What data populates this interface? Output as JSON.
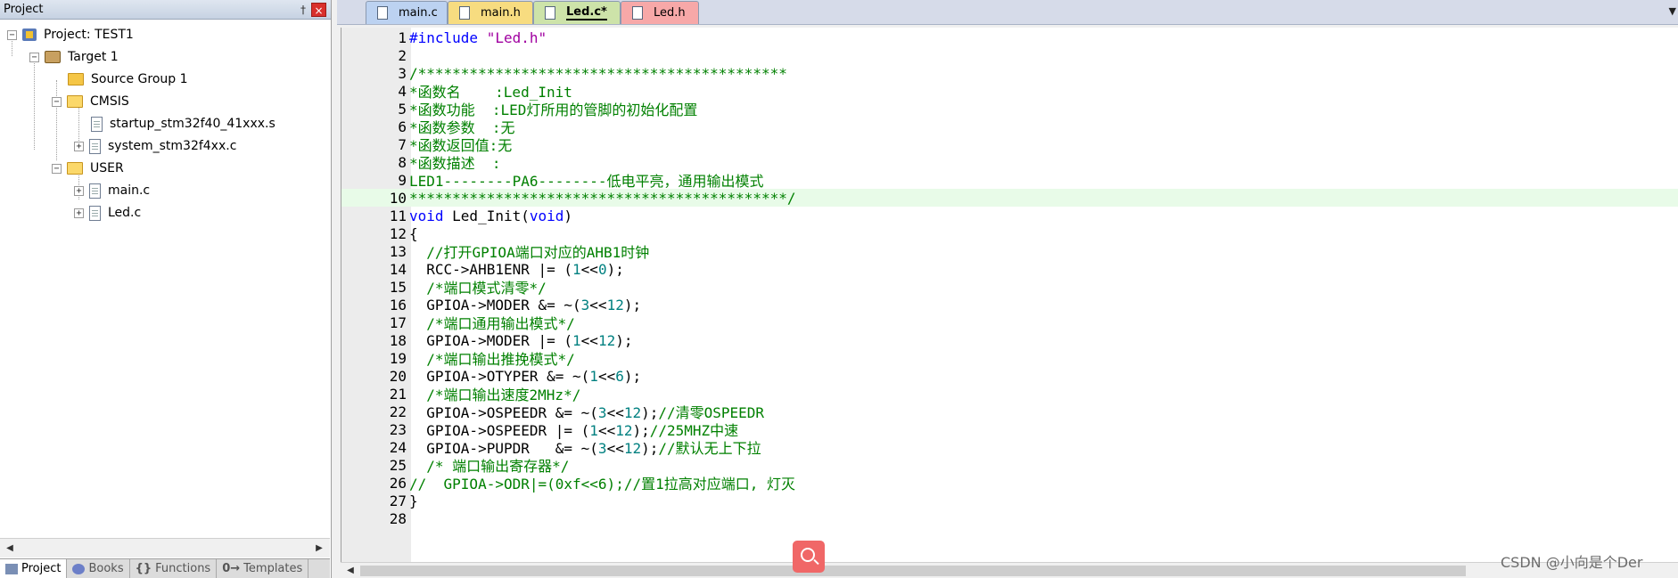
{
  "project_panel": {
    "title": "Project",
    "pin_glyph": "†",
    "close_glyph": "×",
    "tree": [
      {
        "label": "Project: TEST1",
        "icon": "project-icon",
        "expander": "−"
      },
      {
        "label": "Target 1",
        "icon": "target-icon",
        "expander": "−"
      },
      {
        "label": "Source Group 1",
        "icon": "folder-closed-icon",
        "expander": ""
      },
      {
        "label": "CMSIS",
        "icon": "folder-open-icon",
        "expander": "−"
      },
      {
        "label": "startup_stm32f40_41xxx.s",
        "icon": "file-icon",
        "expander": ""
      },
      {
        "label": "system_stm32f4xx.c",
        "icon": "file-icon",
        "expander": "+"
      },
      {
        "label": "USER",
        "icon": "folder-open-icon",
        "expander": "−"
      },
      {
        "label": "main.c",
        "icon": "file-icon",
        "expander": "+"
      },
      {
        "label": "Led.c",
        "icon": "file-icon",
        "expander": "+"
      }
    ],
    "bottom_tabs": [
      {
        "label": "Project",
        "active": true
      },
      {
        "label": "Books",
        "active": false
      },
      {
        "label": "Functions",
        "active": false
      },
      {
        "label": "Templates",
        "active": false
      }
    ],
    "bottom_tab_glyphs": [
      "",
      "",
      "{}",
      "0→"
    ]
  },
  "editor_tabs": [
    {
      "label": "main.c",
      "color": "#bcd2f1"
    },
    {
      "label": "main.h",
      "color": "#f7dc80"
    },
    {
      "label": "Led.c*",
      "color": "#cde3a9",
      "active": true
    },
    {
      "label": "Led.h",
      "color": "#f7a8a8"
    }
  ],
  "editor": {
    "current_line": 10,
    "lines": [
      {
        "n": "1",
        "tokens": [
          [
            "c-keyword",
            "#include "
          ],
          [
            "c-string",
            "\"Led.h\""
          ]
        ]
      },
      {
        "n": "2",
        "tokens": []
      },
      {
        "n": "3",
        "tokens": [
          [
            "c-comment",
            "/*******************************************"
          ]
        ]
      },
      {
        "n": "4",
        "tokens": [
          [
            "c-comment",
            "*函数名    :Led_Init"
          ]
        ]
      },
      {
        "n": "5",
        "tokens": [
          [
            "c-comment",
            "*函数功能  :LED灯所用的管脚的初始化配置"
          ]
        ]
      },
      {
        "n": "6",
        "tokens": [
          [
            "c-comment",
            "*函数参数  :无"
          ]
        ]
      },
      {
        "n": "7",
        "tokens": [
          [
            "c-comment",
            "*函数返回值:无"
          ]
        ]
      },
      {
        "n": "8",
        "tokens": [
          [
            "c-comment",
            "*函数描述  :"
          ]
        ]
      },
      {
        "n": "9",
        "tokens": [
          [
            "c-comment",
            "LED1--------PA6--------低电平亮，通用输出模式"
          ]
        ]
      },
      {
        "n": "10",
        "tokens": [
          [
            "c-comment",
            "********************************************/"
          ]
        ]
      },
      {
        "n": "11",
        "tokens": [
          [
            "c-keyword",
            "void"
          ],
          [
            "c-text",
            " Led_Init("
          ],
          [
            "c-keyword",
            "void"
          ],
          [
            "c-text",
            ")"
          ]
        ]
      },
      {
        "n": "12",
        "tokens": [
          [
            "c-text",
            "{"
          ]
        ]
      },
      {
        "n": "13",
        "tokens": [
          [
            "c-text",
            "  "
          ],
          [
            "c-comment",
            "//打开GPIOA端口对应的AHB1时钟"
          ]
        ]
      },
      {
        "n": "14",
        "tokens": [
          [
            "c-text",
            "  RCC->AHB1ENR |= ("
          ],
          [
            "c-num",
            "1"
          ],
          [
            "c-text",
            "<<"
          ],
          [
            "c-num",
            "0"
          ],
          [
            "c-text",
            ");"
          ]
        ]
      },
      {
        "n": "15",
        "tokens": [
          [
            "c-text",
            "  "
          ],
          [
            "c-comment",
            "/*端口模式清零*/"
          ]
        ]
      },
      {
        "n": "16",
        "tokens": [
          [
            "c-text",
            "  GPIOA->MODER &= ~("
          ],
          [
            "c-num",
            "3"
          ],
          [
            "c-text",
            "<<"
          ],
          [
            "c-num",
            "12"
          ],
          [
            "c-text",
            ");"
          ]
        ]
      },
      {
        "n": "17",
        "tokens": [
          [
            "c-text",
            "  "
          ],
          [
            "c-comment",
            "/*端口通用输出模式*/"
          ]
        ]
      },
      {
        "n": "18",
        "tokens": [
          [
            "c-text",
            "  GPIOA->MODER |= ("
          ],
          [
            "c-num",
            "1"
          ],
          [
            "c-text",
            "<<"
          ],
          [
            "c-num",
            "12"
          ],
          [
            "c-text",
            ");"
          ]
        ]
      },
      {
        "n": "19",
        "tokens": [
          [
            "c-text",
            "  "
          ],
          [
            "c-comment",
            "/*端口输出推挽模式*/"
          ]
        ]
      },
      {
        "n": "20",
        "tokens": [
          [
            "c-text",
            "  GPIOA->OTYPER &= ~("
          ],
          [
            "c-num",
            "1"
          ],
          [
            "c-text",
            "<<"
          ],
          [
            "c-num",
            "6"
          ],
          [
            "c-text",
            ");"
          ]
        ]
      },
      {
        "n": "21",
        "tokens": [
          [
            "c-text",
            "  "
          ],
          [
            "c-comment",
            "/*端口输出速度2MHz*/"
          ]
        ]
      },
      {
        "n": "22",
        "tokens": [
          [
            "c-text",
            "  GPIOA->OSPEEDR &= ~("
          ],
          [
            "c-num",
            "3"
          ],
          [
            "c-text",
            "<<"
          ],
          [
            "c-num",
            "12"
          ],
          [
            "c-text",
            ");"
          ],
          [
            "c-comment",
            "//清零OSPEEDR"
          ]
        ]
      },
      {
        "n": "23",
        "tokens": [
          [
            "c-text",
            "  GPIOA->OSPEEDR |= ("
          ],
          [
            "c-num",
            "1"
          ],
          [
            "c-text",
            "<<"
          ],
          [
            "c-num",
            "12"
          ],
          [
            "c-text",
            ");"
          ],
          [
            "c-comment",
            "//25MHZ中速"
          ]
        ]
      },
      {
        "n": "24",
        "tokens": [
          [
            "c-text",
            "  GPIOA->PUPDR   &= ~("
          ],
          [
            "c-num",
            "3"
          ],
          [
            "c-text",
            "<<"
          ],
          [
            "c-num",
            "12"
          ],
          [
            "c-text",
            ");"
          ],
          [
            "c-comment",
            "//默认无上下拉"
          ]
        ]
      },
      {
        "n": "25",
        "tokens": [
          [
            "c-text",
            "  "
          ],
          [
            "c-comment",
            "/* 端口输出寄存器*/"
          ]
        ]
      },
      {
        "n": "26",
        "tokens": [
          [
            "c-comment",
            "//  GPIOA->ODR|=(0xf<<6);//置1拉高对应端口, 灯灭"
          ]
        ]
      },
      {
        "n": "27",
        "tokens": [
          [
            "c-text",
            "}"
          ]
        ]
      },
      {
        "n": "28",
        "tokens": []
      }
    ]
  },
  "scroll_arrows": {
    "left": "◀",
    "right": "▶",
    "dropdown": "▼"
  },
  "watermark": "CSDN @小向是个Der",
  "colors": {
    "comment": "#008000",
    "keyword": "#0000ff",
    "number": "#008080",
    "current_line": "#e8fbe8",
    "fab": "#f06767"
  }
}
